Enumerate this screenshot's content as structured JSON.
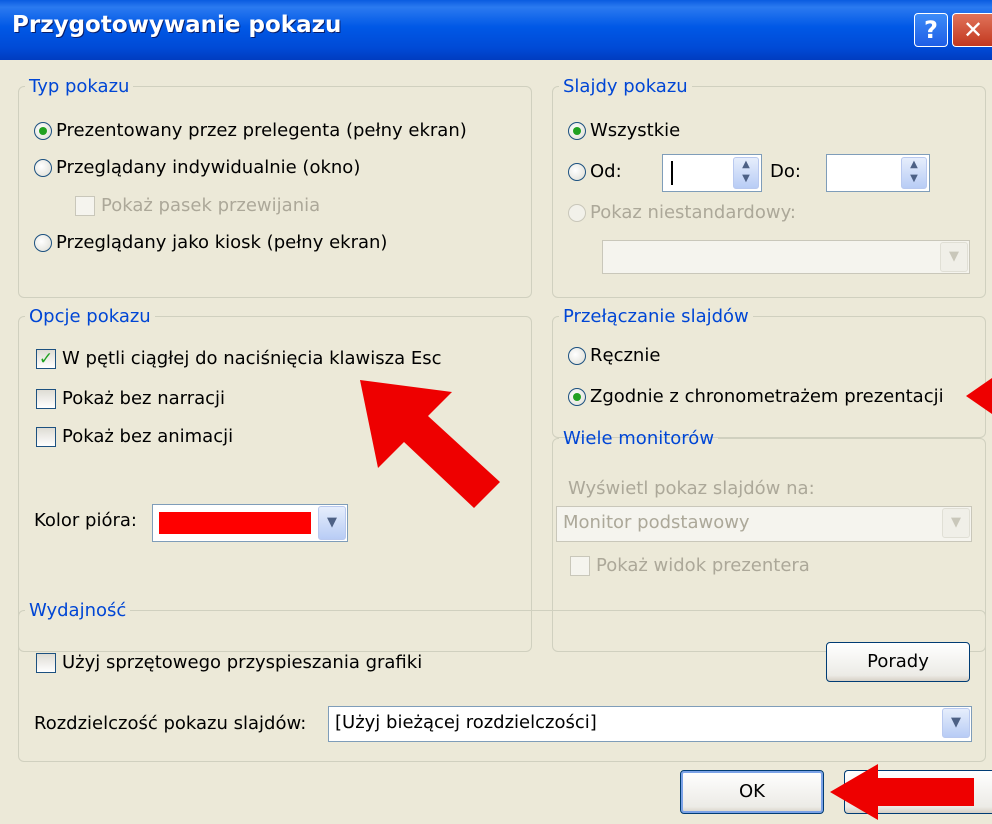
{
  "window": {
    "title": "Przygotowywanie pokazu",
    "help_glyph": "?",
    "close_glyph": "✕"
  },
  "show_type": {
    "legend": "Typ pokazu",
    "options": [
      {
        "label": "Prezentowany przez prelegenta (pełny ekran)",
        "checked": true
      },
      {
        "label": "Przeglądany indywidualnie (okno)",
        "checked": false
      },
      {
        "label": "Przeglądany jako kiosk (pełny ekran)",
        "checked": false
      }
    ],
    "scrollbar_checkbox": {
      "label": "Pokaż pasek przewijania",
      "checked": false,
      "disabled": true
    }
  },
  "show_slides": {
    "legend": "Slajdy pokazu",
    "all_label": "Wszystkie",
    "from_label": "Od:",
    "to_label": "Do:",
    "from_value": "",
    "to_value": "",
    "custom_label": "Pokaz niestandardowy:",
    "custom_value": ""
  },
  "show_options": {
    "legend": "Opcje pokazu",
    "checkboxes": [
      {
        "label": "W pętli ciągłej do naciśnięcia klawisza Esc",
        "checked": true
      },
      {
        "label": "Pokaż bez narracji",
        "checked": false
      },
      {
        "label": "Pokaż bez animacji",
        "checked": false
      }
    ],
    "pen_color_label": "Kolor pióra:",
    "pen_color": "#ff0000"
  },
  "advance_slides": {
    "legend": "Przełączanie slajdów",
    "manual_label": "Ręcznie",
    "timings_label": "Zgodnie z chronometrażem prezentacji",
    "selected": "timings"
  },
  "multiple_monitors": {
    "legend": "Wiele monitorów",
    "display_on_label": "Wyświetl pokaz slajdów na:",
    "monitor_value": "Monitor podstawowy",
    "presenter_view_label": "Pokaż widok prezentera",
    "disabled": true
  },
  "performance": {
    "legend": "Wydajność",
    "hw_accel_label": "Użyj sprzętowego przyspieszania grafiki",
    "hw_accel_checked": false,
    "tips_button": "Porady",
    "resolution_label": "Rozdzielczość pokazu slajdów:",
    "resolution_value": "[Użyj bieżącej rozdzielczości]"
  },
  "buttons": {
    "ok": "OK"
  },
  "icons": {
    "dropdown": "chevron-down-icon",
    "spin": "spin-arrows-icon",
    "annotation": "red-arrow-icon"
  },
  "colors": {
    "legend_text": "#0046d5",
    "title_bar": "#0058e6",
    "annotation_arrow": "#ee0000",
    "checked_mark": "#21a121"
  }
}
